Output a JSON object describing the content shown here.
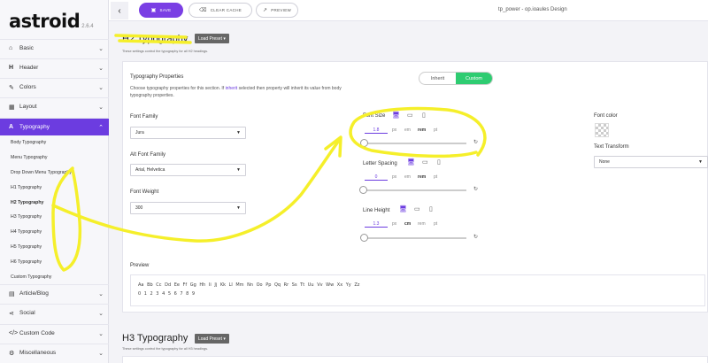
{
  "brand": {
    "name": "astroid",
    "version": "2.6.4"
  },
  "sidebar": {
    "items": [
      {
        "label": "Basic",
        "icon": "home-icon"
      },
      {
        "label": "Header",
        "icon": "header-icon"
      },
      {
        "label": "Colors",
        "icon": "paint-brush-icon"
      },
      {
        "label": "Layout",
        "icon": "layout-icon"
      },
      {
        "label": "Typography",
        "icon": "font-icon"
      }
    ],
    "typography_sub": [
      "Body Typography",
      "Menu Typography",
      "Drop Down Menu Typography",
      "H1 Typography",
      "H2 Typography",
      "H3 Typography",
      "H4 Typography",
      "H5 Typography",
      "H6 Typography",
      "Custom Typography"
    ],
    "bottom_items": [
      {
        "label": "Article/Blog",
        "icon": "file-icon"
      },
      {
        "label": "Social",
        "icon": "share-icon"
      },
      {
        "label": "Custom Code",
        "icon": "code-icon"
      },
      {
        "label": "Miscellaneous",
        "icon": "cog-icon"
      }
    ]
  },
  "toolbar": {
    "save": "SAVE",
    "clear_cache": "CLEAR CACHE",
    "preview": "PREVIEW",
    "title": "tp_power - op.ioaules Design"
  },
  "h2": {
    "heading": "H2 Typography",
    "preset": "Load Preset ▾",
    "description": "These settings control the typography for all H2 headings.",
    "props_title": "Typography Properties",
    "props_desc_1": "Choose typography properties for this section. If ",
    "props_desc_inherit": "inherit",
    "props_desc_2": " selected then property will inherit its value from body",
    "props_desc_3": "typography properties.",
    "toggle": {
      "inherit": "Inherit",
      "custom": "Custom"
    },
    "font_family_label": "Font Family",
    "font_family_value": "Jura",
    "alt_font_family_label": "Alt Font Family",
    "alt_font_family_value": "Arial, Helvetica",
    "font_weight_label": "Font Weight",
    "font_weight_value": "300",
    "font_size_label": "Font Size",
    "font_size_value": "1.8",
    "letter_spacing_label": "Letter Spacing",
    "letter_spacing_value": "0",
    "line_height_label": "Line Height",
    "line_height_value": "1.3",
    "units": [
      "px",
      "em",
      "rem",
      "pt"
    ],
    "lh_units": [
      "px",
      "cm",
      "rem",
      "pt"
    ],
    "font_color_label": "Font color",
    "text_transform_label": "Text Transform",
    "text_transform_value": "None",
    "preview_label": "Preview",
    "preview_line1": "Aa Bb Cc Dd Ee Ff Gg Hh Ii Jj Kk Ll Mm Nn Oo Pp Qq Rr Ss Tt Uu Vv Ww Xx Yy Zz",
    "preview_line2": "0 1 2 3 4 5 6 7 8 9"
  },
  "h3": {
    "heading": "H3 Typography",
    "preset": "Load Preset ▾",
    "description": "These settings control the typography for all H3 headings."
  },
  "colors": {
    "accent": "#6c3ce0",
    "toggle_on": "#2ecc71",
    "highlight": "#f5ef2a"
  }
}
